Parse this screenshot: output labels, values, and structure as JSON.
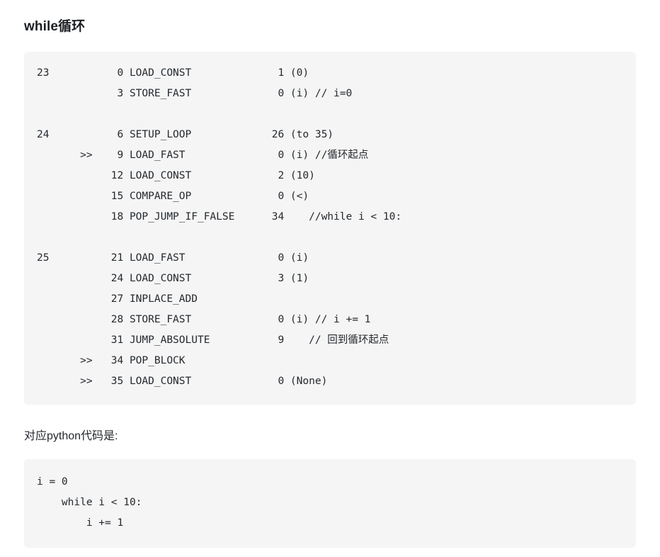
{
  "page": {
    "title": "while循环",
    "paragraph": "对应python代码是:",
    "background_color": "#ffffff",
    "text_color": "#24292e",
    "code_block_background": "#f5f5f5"
  },
  "disassembly_block": {
    "language": "python-bytecode",
    "columns": [
      "line_number",
      "jump_marker",
      "offset",
      "opname",
      "arg",
      "argrepr_and_comment"
    ],
    "rows": [
      {
        "line_number": "23",
        "jump_marker": "",
        "offset": "0",
        "opname": "LOAD_CONST",
        "arg": "1",
        "argrepr": "(0)"
      },
      {
        "line_number": "",
        "jump_marker": "",
        "offset": "3",
        "opname": "STORE_FAST",
        "arg": "0",
        "argrepr": "(i) // i=0"
      },
      {
        "blank": true
      },
      {
        "line_number": "24",
        "jump_marker": "",
        "offset": "6",
        "opname": "SETUP_LOOP",
        "arg": "26",
        "argrepr": "(to 35)"
      },
      {
        "line_number": "",
        "jump_marker": ">>",
        "offset": "9",
        "opname": "LOAD_FAST",
        "arg": "0",
        "argrepr": "(i) //循环起点"
      },
      {
        "line_number": "",
        "jump_marker": "",
        "offset": "12",
        "opname": "LOAD_CONST",
        "arg": "2",
        "argrepr": "(10)"
      },
      {
        "line_number": "",
        "jump_marker": "",
        "offset": "15",
        "opname": "COMPARE_OP",
        "arg": "0",
        "argrepr": "(<)"
      },
      {
        "line_number": "",
        "jump_marker": "",
        "offset": "18",
        "opname": "POP_JUMP_IF_FALSE",
        "arg": "34",
        "argrepr": "   //while i < 10:"
      },
      {
        "blank": true
      },
      {
        "line_number": "25",
        "jump_marker": "",
        "offset": "21",
        "opname": "LOAD_FAST",
        "arg": "0",
        "argrepr": "(i)"
      },
      {
        "line_number": "",
        "jump_marker": "",
        "offset": "24",
        "opname": "LOAD_CONST",
        "arg": "3",
        "argrepr": "(1)"
      },
      {
        "line_number": "",
        "jump_marker": "",
        "offset": "27",
        "opname": "INPLACE_ADD",
        "arg": "",
        "argrepr": ""
      },
      {
        "line_number": "",
        "jump_marker": "",
        "offset": "28",
        "opname": "STORE_FAST",
        "arg": "0",
        "argrepr": "(i) // i += 1"
      },
      {
        "line_number": "",
        "jump_marker": "",
        "offset": "31",
        "opname": "JUMP_ABSOLUTE",
        "arg": "9",
        "argrepr": "   // 回到循环起点"
      },
      {
        "line_number": "",
        "jump_marker": ">>",
        "offset": "34",
        "opname": "POP_BLOCK",
        "arg": "",
        "argrepr": ""
      },
      {
        "line_number": "",
        "jump_marker": ">>",
        "offset": "35",
        "opname": "LOAD_CONST",
        "arg": "0",
        "argrepr": "(None)"
      }
    ],
    "text": "23           0 LOAD_CONST              1 (0)\n             3 STORE_FAST              0 (i) // i=0\n\n24           6 SETUP_LOOP             26 (to 35)\n       >>    9 LOAD_FAST               0 (i) //循环起点\n            12 LOAD_CONST              2 (10)\n            15 COMPARE_OP              0 (<)\n            18 POP_JUMP_IF_FALSE      34    //while i < 10:\n\n25          21 LOAD_FAST               0 (i)\n            24 LOAD_CONST              3 (1)\n            27 INPLACE_ADD\n            28 STORE_FAST              0 (i) // i += 1\n            31 JUMP_ABSOLUTE           9    // 回到循环起点\n       >>   34 POP_BLOCK\n       >>   35 LOAD_CONST              0 (None)"
  },
  "python_block": {
    "language": "python",
    "lines": [
      "i = 0",
      "    while i < 10:",
      "        i += 1"
    ],
    "text": "i = 0\n    while i < 10:\n        i += 1"
  }
}
